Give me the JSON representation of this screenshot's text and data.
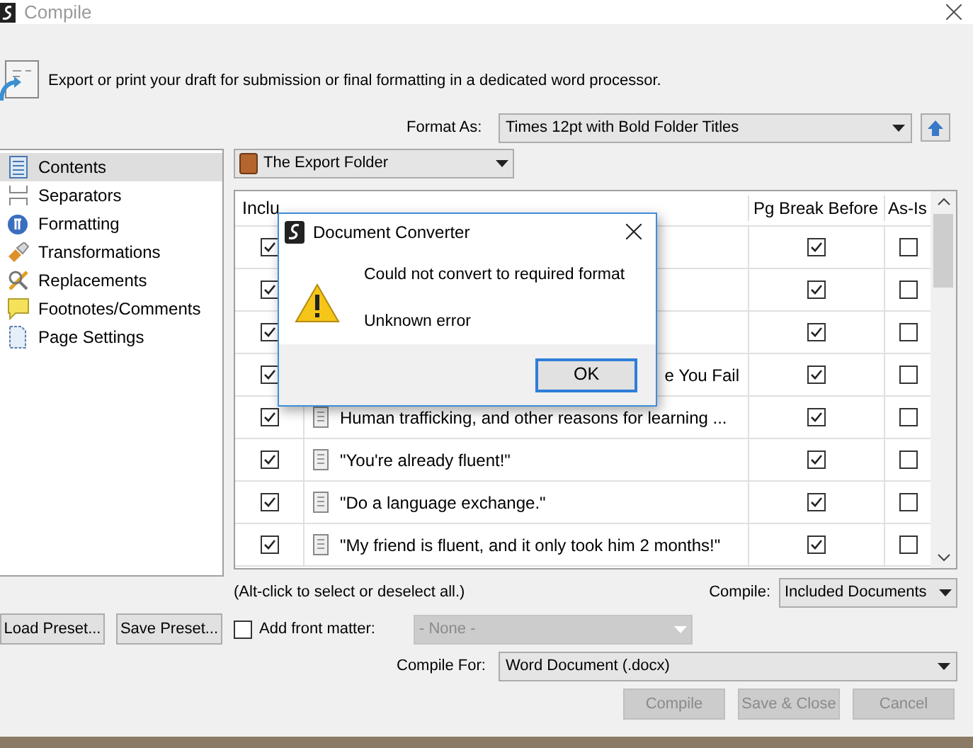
{
  "window": {
    "title": "Compile"
  },
  "description": "Export or print your draft for submission or final formatting in a dedicated word processor.",
  "format_as": {
    "label": "Format As:",
    "value": "Times 12pt with Bold Folder Titles"
  },
  "sidebar": {
    "items": [
      {
        "label": "Contents",
        "selected": true
      },
      {
        "label": "Separators",
        "selected": false
      },
      {
        "label": "Formatting",
        "selected": false
      },
      {
        "label": "Transformations",
        "selected": false
      },
      {
        "label": "Replacements",
        "selected": false
      },
      {
        "label": "Footnotes/Comments",
        "selected": false
      },
      {
        "label": "Page Settings",
        "selected": false
      }
    ]
  },
  "folder_select": {
    "value": "The Export Folder"
  },
  "table": {
    "columns": [
      "Inclu",
      "Pg Break Before",
      "As-Is"
    ],
    "rows": [
      {
        "include": true,
        "pg_break": true,
        "as_is": false
      },
      {
        "include": true,
        "pg_break": true,
        "as_is": false
      },
      {
        "include": true,
        "pg_break": true,
        "as_is": false
      },
      {
        "include": true,
        "kind": "partial",
        "title": "e You Fail",
        "pg_break": true,
        "as_is": false
      },
      {
        "include": true,
        "kind": "document",
        "title": "Human trafficking, and other reasons for learning ...",
        "pg_break": true,
        "as_is": false
      },
      {
        "include": true,
        "kind": "document",
        "title": "\"You're already fluent!\"",
        "pg_break": true,
        "as_is": false
      },
      {
        "include": true,
        "kind": "document",
        "title": "\"Do a language exchange.\"",
        "pg_break": true,
        "as_is": false
      },
      {
        "include": true,
        "kind": "document",
        "title": "\"My friend is fluent, and it only took him 2 months!\"",
        "pg_break": true,
        "as_is": false
      }
    ]
  },
  "hint": "(Alt-click to select or deselect all.)",
  "compile_select": {
    "label": "Compile:",
    "value": "Included Documents"
  },
  "front_matter": {
    "label": "Add front matter:",
    "checked": false,
    "value": "- None -",
    "disabled": true
  },
  "preset_buttons": [
    "Load Preset...",
    "Save Preset..."
  ],
  "compile_for": {
    "label": "Compile For:",
    "value": "Word Document (.docx)"
  },
  "buttons": [
    {
      "label": "Compile",
      "disabled": true
    },
    {
      "label": "Save & Close",
      "disabled": true
    },
    {
      "label": "Cancel",
      "disabled": true
    }
  ],
  "dialog": {
    "title": "Document Converter",
    "message": "Could not convert to required format",
    "detail": "Unknown error",
    "button": "OK"
  }
}
